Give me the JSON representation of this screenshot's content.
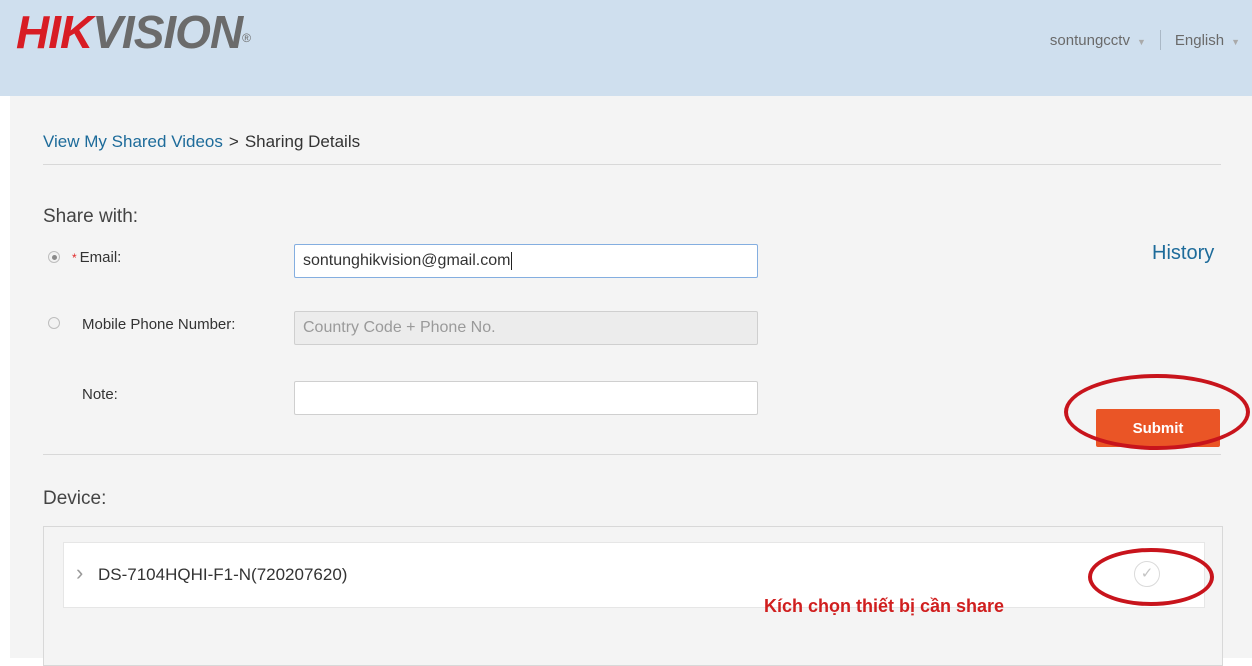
{
  "header": {
    "logo_red": "HIK",
    "logo_gray": "VISION",
    "logo_mark": "®",
    "username": "sontungcctv",
    "language": "English"
  },
  "breadcrumb": {
    "link": "View My Shared Videos",
    "separator": ">",
    "current": "Sharing Details"
  },
  "share": {
    "title": "Share with:",
    "email_required_mark": "*",
    "email_label": "Email:",
    "email_value": "sontunghikvision@gmail.com",
    "email_selected": true,
    "phone_label": "Mobile Phone Number:",
    "phone_placeholder": "Country Code + Phone No.",
    "note_label": "Note:",
    "note_value": "",
    "history_link": "History",
    "submit_label": "Submit"
  },
  "device_section": {
    "title": "Device:",
    "devices": [
      {
        "name": "DS-7104HQHI-F1-N(720207620)"
      }
    ]
  },
  "annotation": {
    "text": "Kích chọn thiết bị cần share",
    "color": "#c8141c"
  }
}
